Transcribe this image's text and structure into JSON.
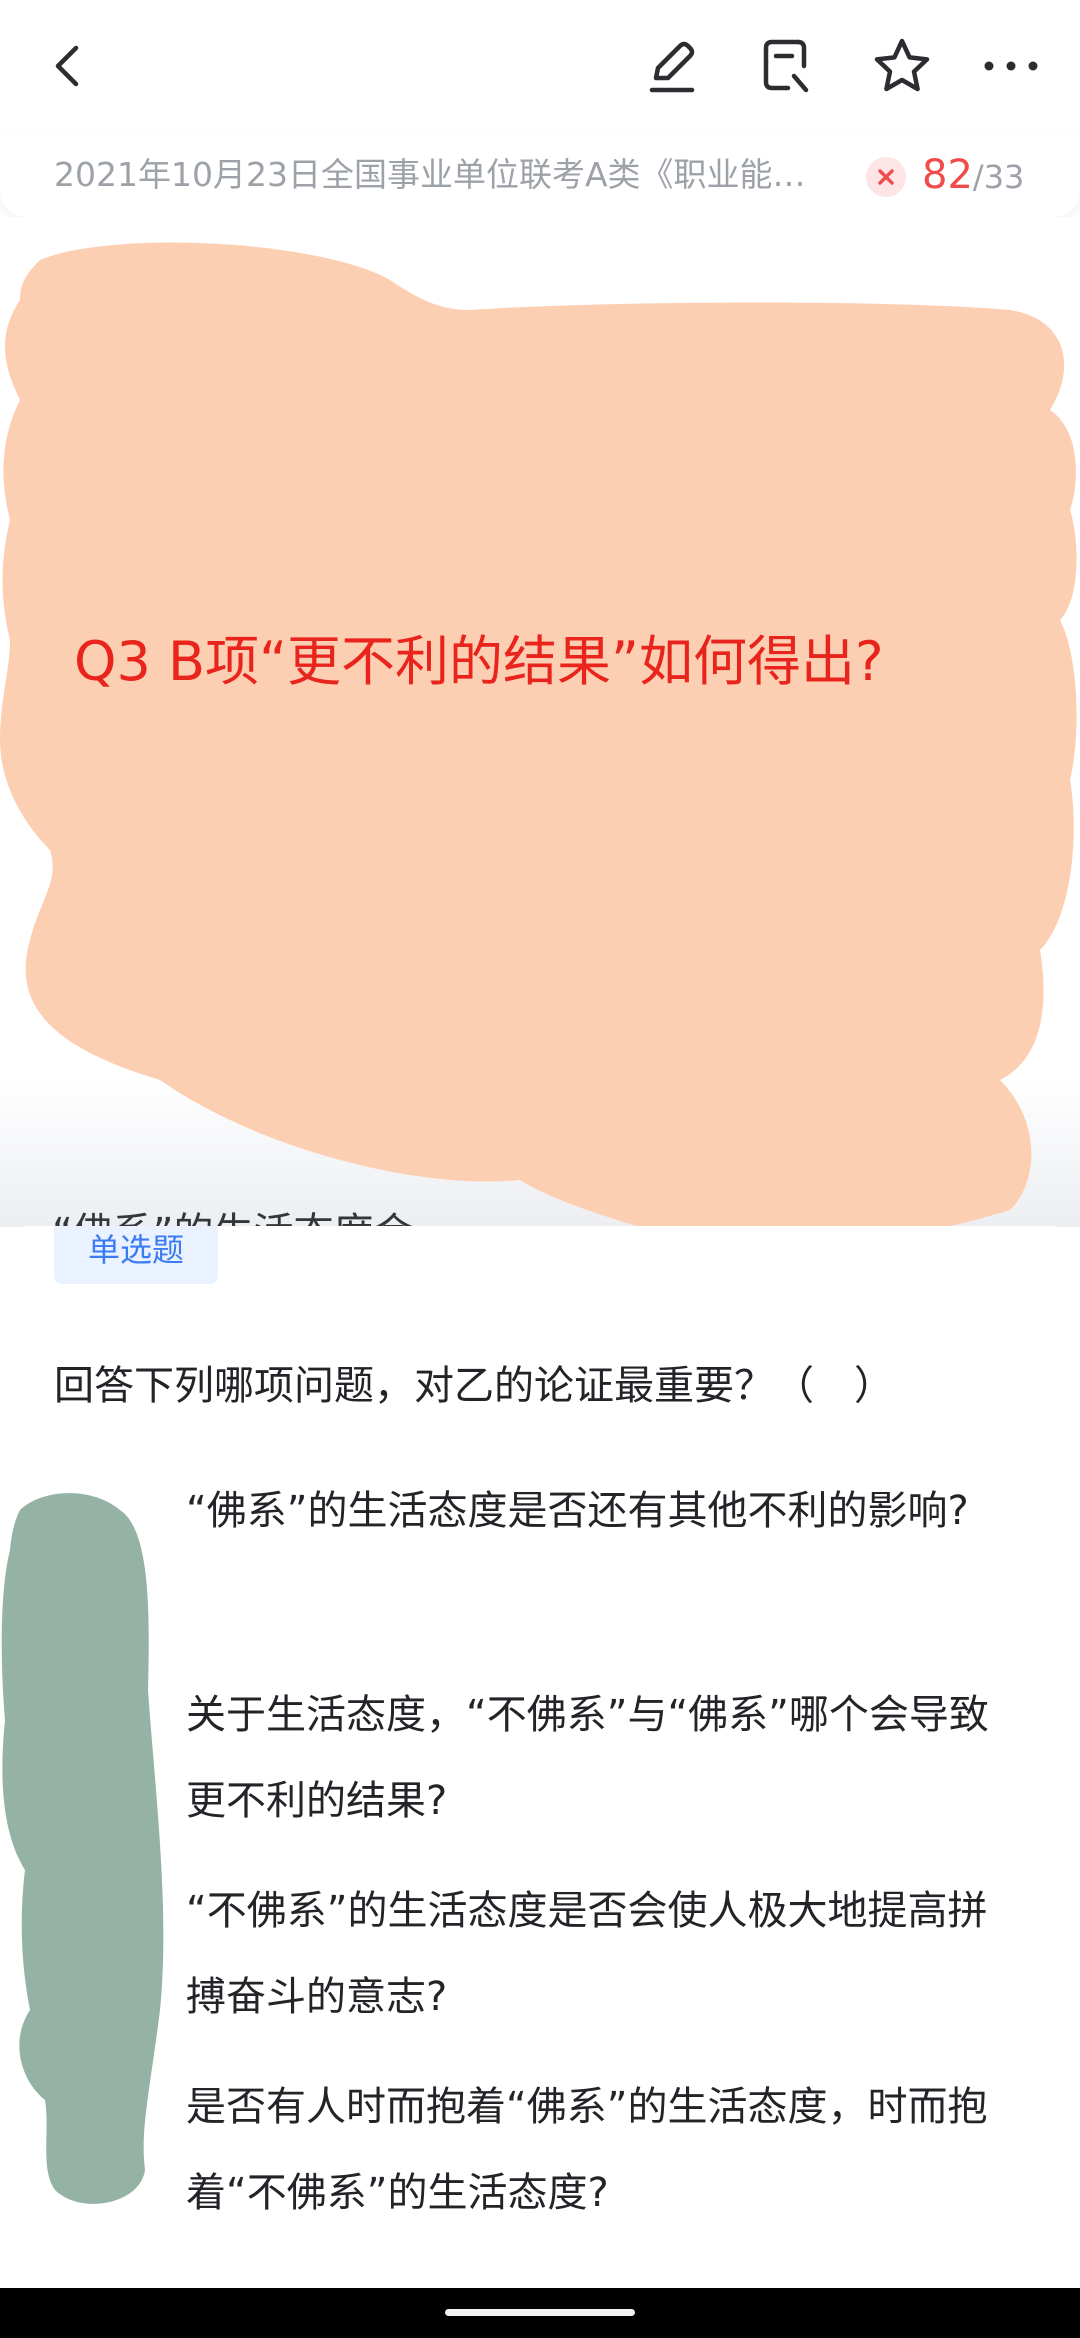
{
  "topbar": {
    "back_icon": "chevron-left-icon",
    "edit_icon": "pencil-icon",
    "note_icon": "note-edit-icon",
    "favorite_icon": "star-icon",
    "more_icon": "more-dots-icon"
  },
  "header": {
    "exam_title": "2021年10月23日全国事业单位联考A类《职业能…",
    "status_icon": "wrong-x-icon",
    "current": "82",
    "separator": "/",
    "total": "33"
  },
  "passage": {
    "peek_text": "“佛系”的生活态度会"
  },
  "overlay": {
    "handwritten_question": "Q3 B项“更不利的结果”如何得出?",
    "cover_color": "#fdcfb2"
  },
  "question": {
    "type_label": "单选题",
    "stem": "回答下列哪项问题，对乙的论证最重要？（　）",
    "options": [
      {
        "text": "“佛系”的生活态度是否还有其他不利的影响?"
      },
      {
        "text": "关于生活态度，“不佛系”与“佛系”哪个会导致更不利的结果?"
      },
      {
        "text": "“不佛系”的生活态度是否会使人极大地提高拼搏奋斗的意志?"
      },
      {
        "text": "是否有人时而抱着“佛系”的生活态度，时而抱着“不佛系”的生活态度?"
      }
    ]
  },
  "colors": {
    "accent_red": "#f24b4b",
    "tag_blue": "#3b7cf5",
    "mark_green": "#94b3a5",
    "overlay_red": "#e8241c"
  }
}
